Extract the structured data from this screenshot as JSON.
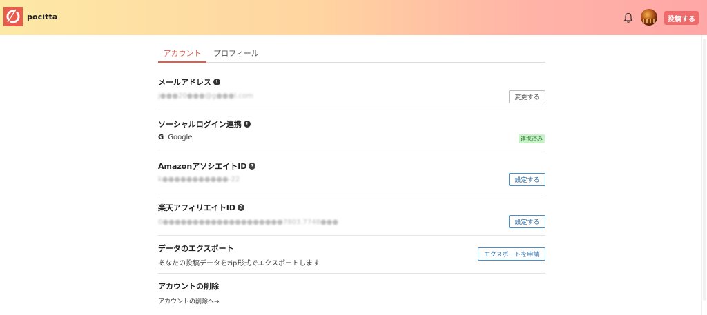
{
  "header": {
    "brand": "pocitta",
    "post_button": "投稿する"
  },
  "tabs": [
    {
      "label": "アカウント",
      "active": true
    },
    {
      "label": "プロフィール",
      "active": false
    }
  ],
  "email": {
    "title": "メールアドレス",
    "value": "j●●●20●●●@g●●●l.com",
    "button": "変更する"
  },
  "social": {
    "title": "ソーシャルログイン連携",
    "provider": "Google",
    "status": "連携済み"
  },
  "amazon": {
    "title": "AmazonアソシエイトID",
    "value": "k●●●●●●●●●●●-22",
    "button": "設定する"
  },
  "rakuten": {
    "title": "楽天アフィリエイトID",
    "value": "0●●●●●●●●●●●●●●●●●●●●7803.7748●●●",
    "button": "設定する"
  },
  "export": {
    "title": "データのエクスポート",
    "description": "あなたの投稿データをzip形式でエクスポートします",
    "button": "エクスポートを申請"
  },
  "delete": {
    "title": "アカウントの削除",
    "link": "アカウントの削除へ→"
  },
  "colors": {
    "accent": "#e45a4c",
    "brand": "#e95b4d",
    "post_button": "#ef6b6b",
    "link_blue": "#2a6ea8",
    "success": "#2e7d32"
  }
}
